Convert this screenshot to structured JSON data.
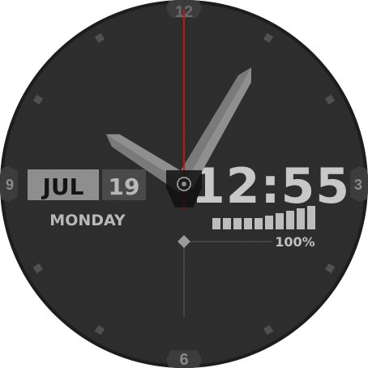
{
  "dial": {
    "numerals": {
      "top": "12",
      "right": "3",
      "bottom": "6",
      "left": "9"
    }
  },
  "date": {
    "month": "JUL",
    "day": "19",
    "weekday": "MONDAY"
  },
  "digital_time": "12:55",
  "battery": {
    "level": 1.0,
    "label": "100%",
    "segments": 10
  },
  "analog": {
    "hour": 10,
    "minute": 5,
    "second": 0
  },
  "colors": {
    "face": "#2c2c2c",
    "face_edge": "#1c1c1c",
    "hands": "#8f8f8f",
    "hand_shadow": "#5e5e5e",
    "second_hand": "#c01818",
    "text": "#c8c8c8",
    "date_box": "#8e8e8e",
    "date_box_text": "#151515",
    "day_box": "#4a4a4a",
    "marker": "#505050"
  },
  "icons": {
    "center_cap": "circle-cap-icon",
    "battery_pointer": "diamond-icon"
  }
}
